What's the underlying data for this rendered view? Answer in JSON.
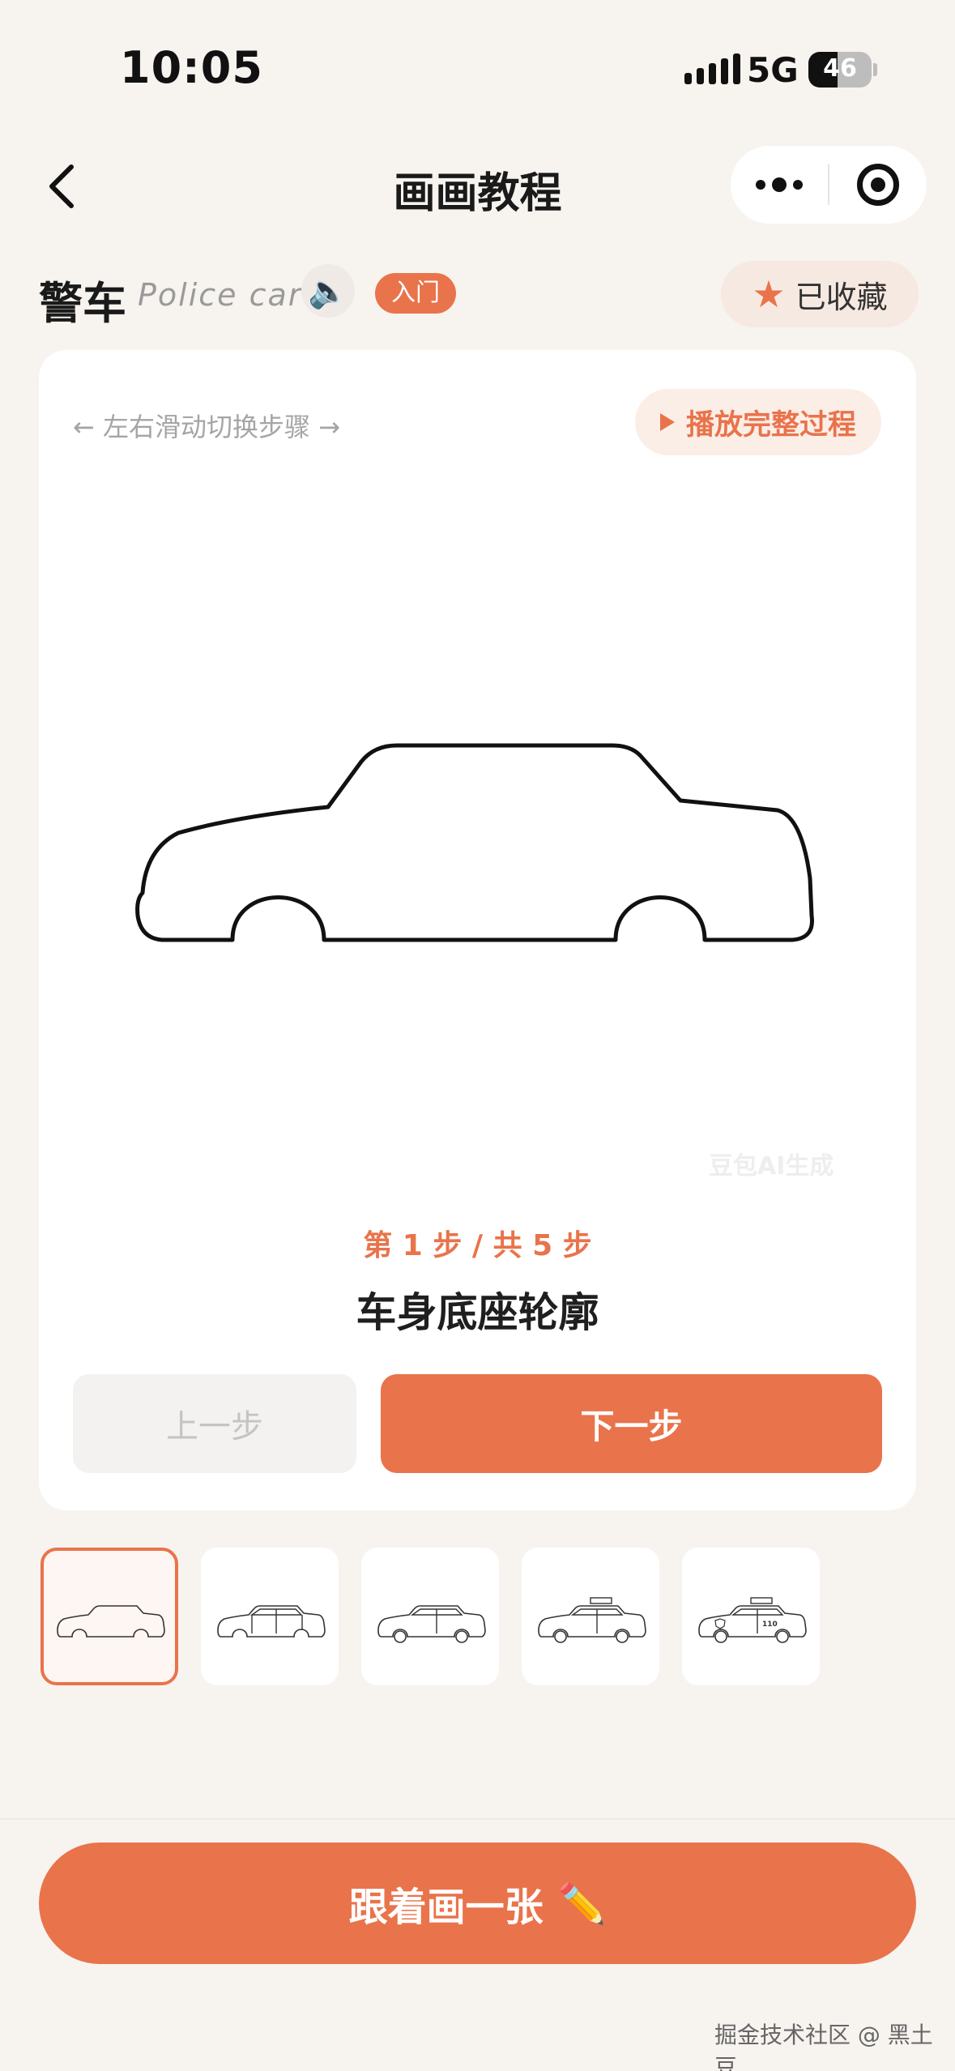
{
  "status_bar": {
    "time": "10:05",
    "network": "5G",
    "battery": "46",
    "battery_level": 0.46
  },
  "nav": {
    "title": "画画教程",
    "back_icon": "chevron-left-icon",
    "more_icon": "more-dots-icon",
    "close_icon": "target-close-icon"
  },
  "subject": {
    "name_cn": "警车",
    "name_en": "Police car",
    "speaker_icon": "speaker-icon",
    "level": "入门"
  },
  "favorite": {
    "label": "已收藏",
    "icon": "star-icon"
  },
  "tutorial": {
    "swipe_hint": "← 左右滑动切换步骤 →",
    "play_full": "播放完整过程",
    "watermark": "豆包AI生成",
    "counter": "第 1 步 / 共 5 步",
    "step_title": "车身底座轮廓",
    "prev_label": "上一步",
    "next_label": "下一步",
    "current_step": 1,
    "total_steps": 5
  },
  "thumbnails": [
    {
      "step": 1,
      "text": ""
    },
    {
      "step": 2,
      "text": ""
    },
    {
      "step": 3,
      "text": ""
    },
    {
      "step": 4,
      "text": ""
    },
    {
      "step": 5,
      "text": "110"
    }
  ],
  "cta": {
    "label": "跟着画一张",
    "icon": "✏️"
  },
  "credit": "掘金技术社区 @ 黑土豆",
  "colors": {
    "accent": "#e9734b",
    "background": "#f7f3ef",
    "card": "#ffffff"
  }
}
